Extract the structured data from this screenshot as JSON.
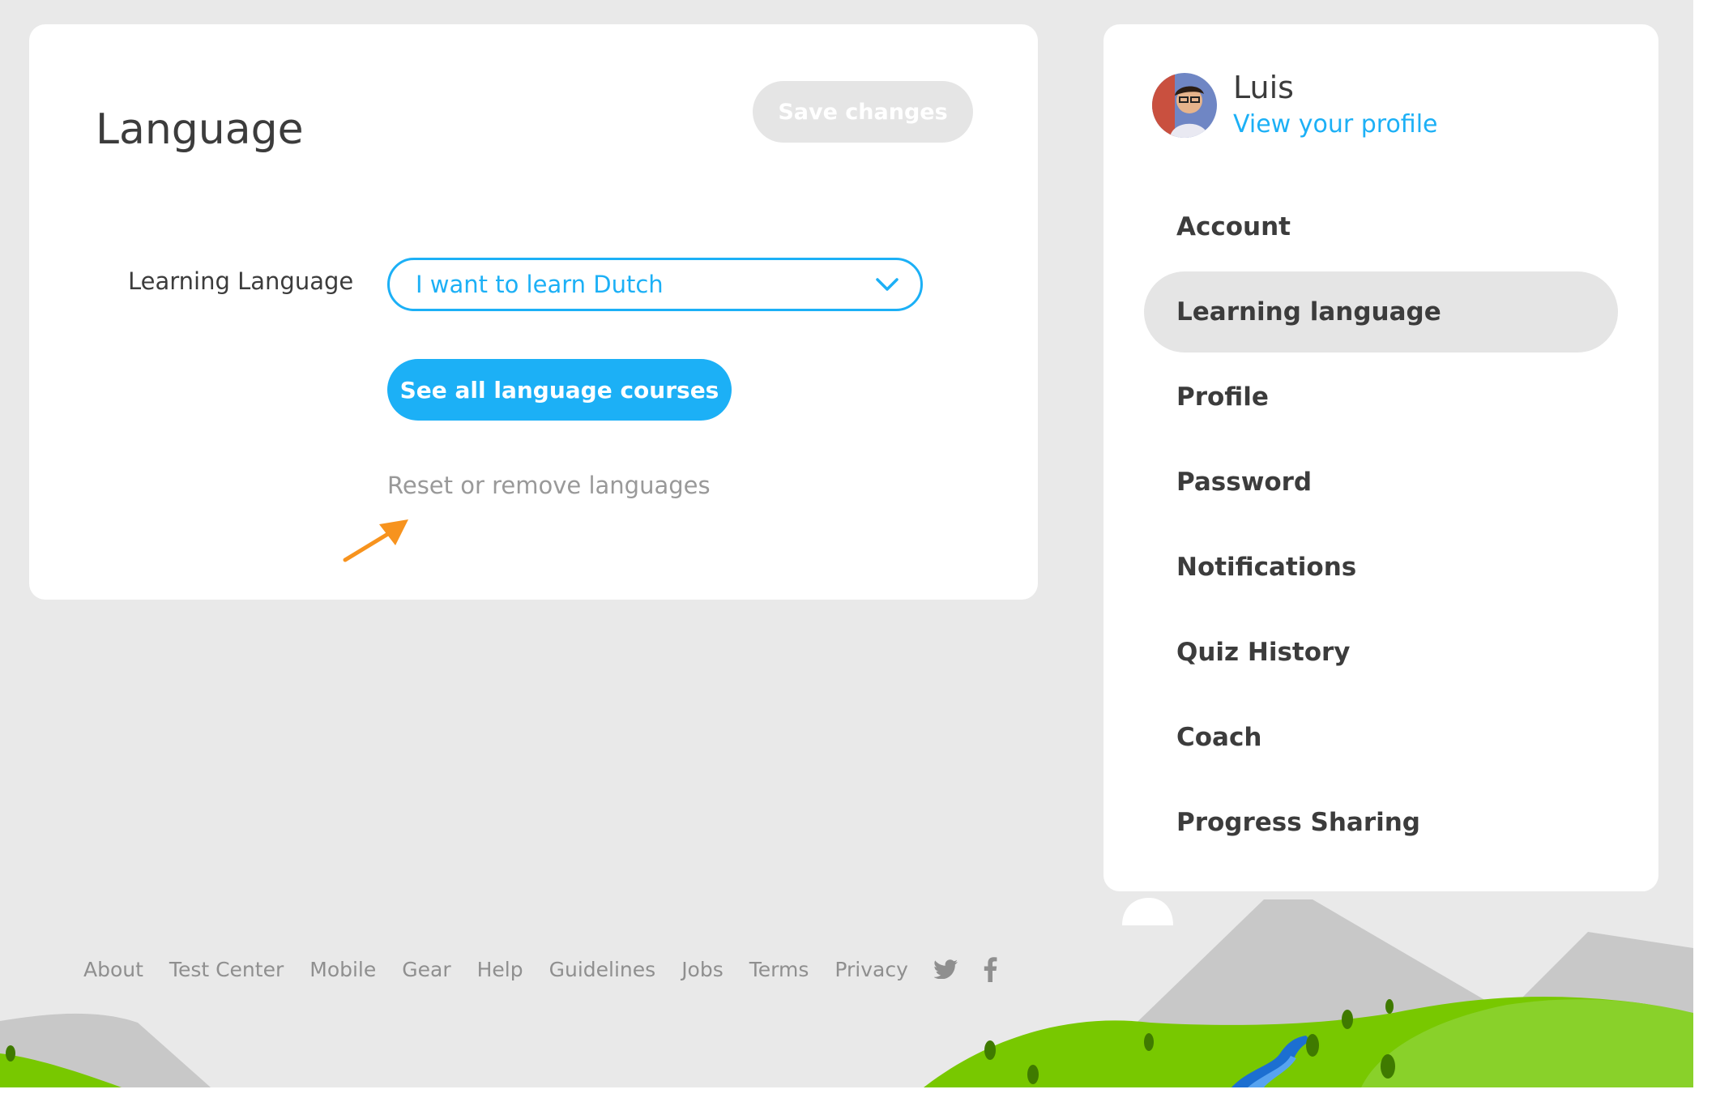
{
  "main": {
    "title": "Language",
    "save_label": "Save changes",
    "learning_label": "Learning Language",
    "selected_language": "I want to learn Dutch",
    "courses_button": "See all language courses",
    "reset_link": "Reset or remove languages"
  },
  "sidebar": {
    "user_name": "Luis",
    "profile_link": "View your profile",
    "items": [
      {
        "label": "Account",
        "active": false
      },
      {
        "label": "Learning language",
        "active": true
      },
      {
        "label": "Profile",
        "active": false
      },
      {
        "label": "Password",
        "active": false
      },
      {
        "label": "Notifications",
        "active": false
      },
      {
        "label": "Quiz History",
        "active": false
      },
      {
        "label": "Coach",
        "active": false
      },
      {
        "label": "Progress Sharing",
        "active": false
      }
    ]
  },
  "footer": {
    "links": [
      "About",
      "Test Center",
      "Mobile",
      "Gear",
      "Help",
      "Guidelines",
      "Jobs",
      "Terms",
      "Privacy"
    ],
    "social_icons": [
      "twitter-icon",
      "facebook-icon"
    ]
  },
  "colors": {
    "accent": "#1cb0f6",
    "disabled": "#e5e5e5",
    "arrow": "#f7931e",
    "grass": "#78c800"
  }
}
